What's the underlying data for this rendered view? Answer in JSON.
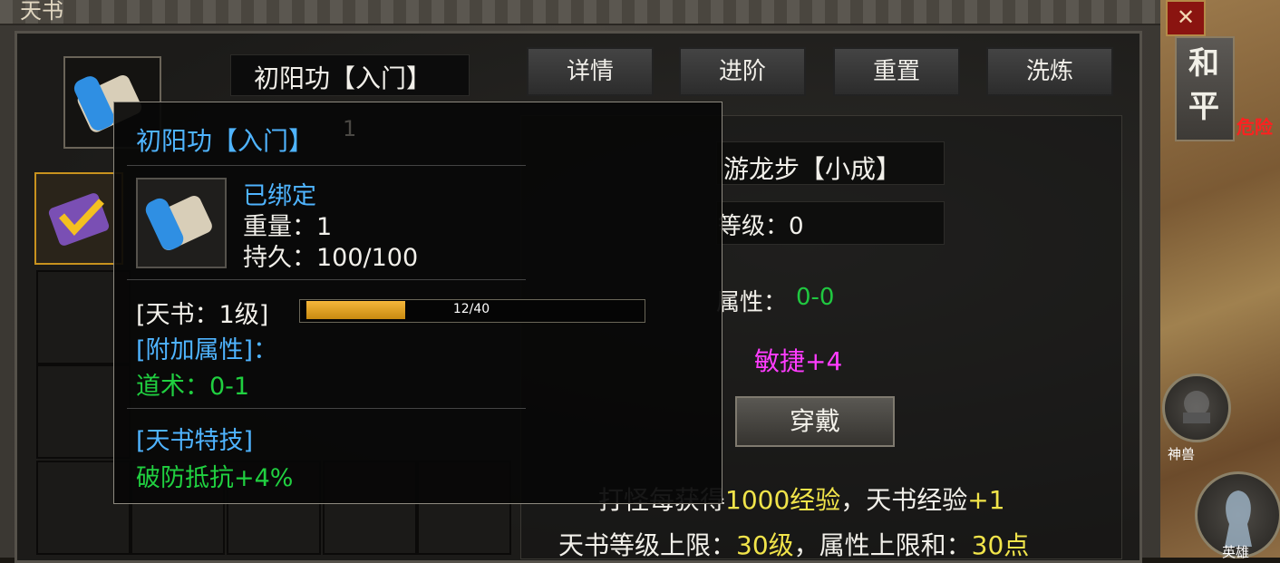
{
  "window": {
    "title": "天书",
    "close_label": "✕"
  },
  "top": {
    "skill_name": "初阳功【入门】"
  },
  "tabs": [
    {
      "label": "详情"
    },
    {
      "label": "进阶"
    },
    {
      "label": "重置"
    },
    {
      "label": "洗炼"
    }
  ],
  "tooltip": {
    "title": "初阳功【入门】",
    "stack_count": "1",
    "bound": "已绑定",
    "weight": "重量：1",
    "durability": "持久：100/100",
    "level_label": "[天书：1级]",
    "exp_bar_text": "12/40",
    "exp_progress": 0.3,
    "extra_header": "[附加属性]：",
    "extra_value": "道术：0-1",
    "skill_header": "[天书特技]",
    "skill_value": "破防抵抗+4%"
  },
  "right_panel": {
    "skill_name": "游龙步【小成】",
    "level": "等级：0",
    "attr_label": "属性：",
    "attr_value": "0-0",
    "agility": "敏捷+4",
    "equip_button": "穿戴",
    "exp_prefix": "打怪每获得",
    "exp_amount": "1000经验",
    "exp_mid": "，天书经验",
    "exp_gain": "+1",
    "cap_prefix": "天书等级上限：",
    "cap_level": "30级",
    "cap_mid": "，属性上限和：",
    "cap_points": "30点"
  },
  "map": {
    "pk_mode": "和平",
    "danger_label": "危险",
    "pet_button": "神兽",
    "hero_button": "英雄"
  }
}
